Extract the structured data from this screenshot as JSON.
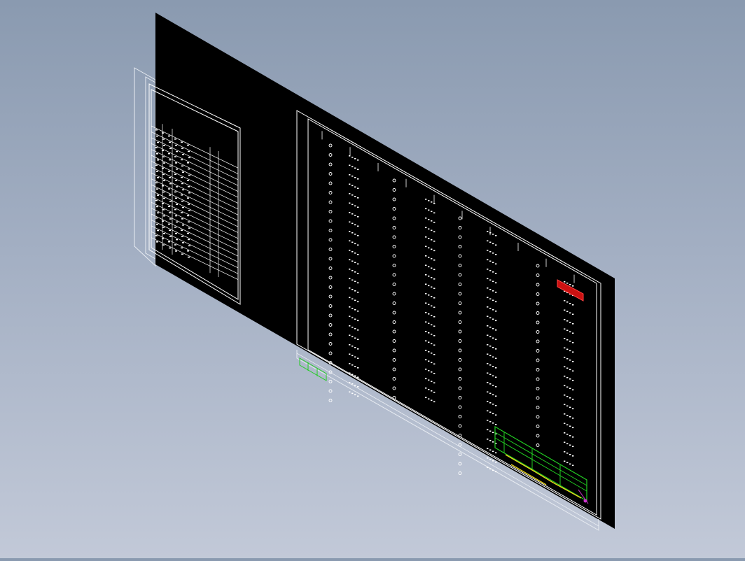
{
  "viewport": {
    "background_top": "#8a9ab0",
    "background_bottom": "#c2c9d8",
    "sheet_color": "#000000",
    "line_color": "#ffffff",
    "accent_red": "#cc1111",
    "accent_green": "#22cc22",
    "accent_yellow": "#e6d21a",
    "accent_magenta": "#cc33cc"
  },
  "left_table": {
    "row_count": 20,
    "column_count": 4
  },
  "schematic": {
    "symbol_columns": 7,
    "title_block_colors": [
      "green",
      "yellow"
    ]
  },
  "icons": [
    "cad-sheet-icon"
  ]
}
